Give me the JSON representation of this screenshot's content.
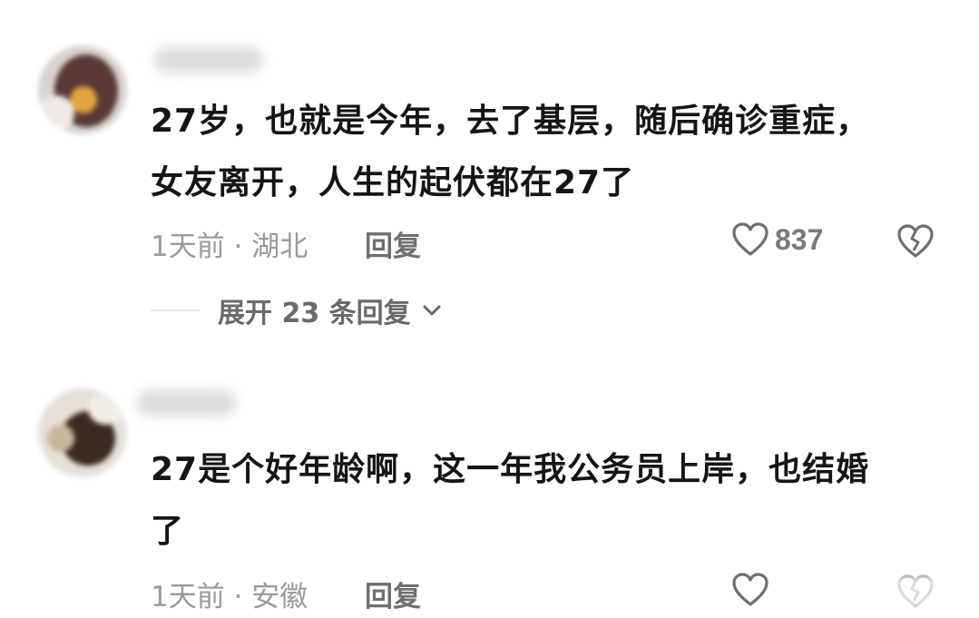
{
  "comments": [
    {
      "text_lines": [
        "27岁，也就是今年，去了基层，随后确诊重症，",
        "女友离开，人生的起伏都在27了"
      ],
      "time": "1天前",
      "location_sep": " · ",
      "location": "湖北",
      "reply_label": "回复",
      "likes": "837",
      "expand_label": "展开 23 条回复"
    },
    {
      "text_lines": [
        "27是个好年龄啊，这一年我公务员上岸，也结婚",
        "了"
      ],
      "time": "1天前",
      "location_sep": " · ",
      "location": "安徽",
      "reply_label": "回复"
    }
  ],
  "icons": {
    "like": "heart-outline-icon",
    "dislike": "broken-heart-icon",
    "expand": "chevron-down-icon"
  },
  "colors": {
    "text": "#151515",
    "meta": "#9a9a9a",
    "icon": "#6f6f6f"
  }
}
